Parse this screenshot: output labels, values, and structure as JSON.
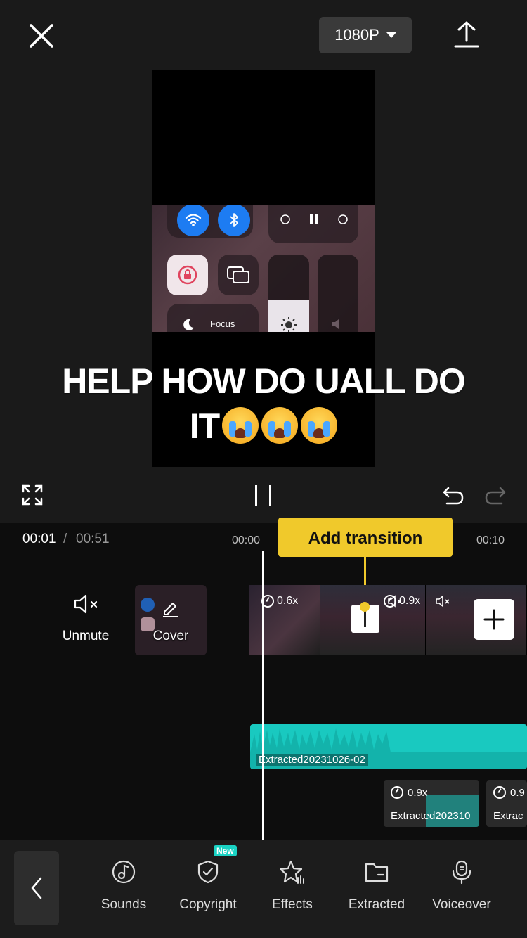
{
  "header": {
    "resolution": "1080P"
  },
  "preview": {
    "caption_line1": "HELP HOW DO UALL DO",
    "caption_line2": "IT",
    "focus_label": "Focus"
  },
  "timeline": {
    "current_time": "00:01",
    "separator": "/",
    "total_time": "00:51",
    "tick_start": "00:00",
    "tick_end": "00:10",
    "add_transition_label": "Add transition",
    "unmute_label": "Unmute",
    "cover_label": "Cover",
    "clip1_speed": "0.6x",
    "clip2_speed": "0.9x",
    "audio_main_label": "Extracted20231026-02",
    "audio_sub1_speed": "0.9x",
    "audio_sub1_label": "Extracted202310",
    "audio_sub2_speed": "0.9",
    "audio_sub2_label": "Extrac"
  },
  "toolbar": {
    "sounds": "Sounds",
    "copyright": "Copyright",
    "new_badge": "New",
    "effects": "Effects",
    "extracted": "Extracted",
    "voiceover": "Voiceover"
  },
  "colors": {
    "accent_yellow": "#f0c92b",
    "audio_teal": "#19c9c0",
    "badge_teal": "#1ad3c4",
    "ios_blue": "#1d7cf2"
  }
}
